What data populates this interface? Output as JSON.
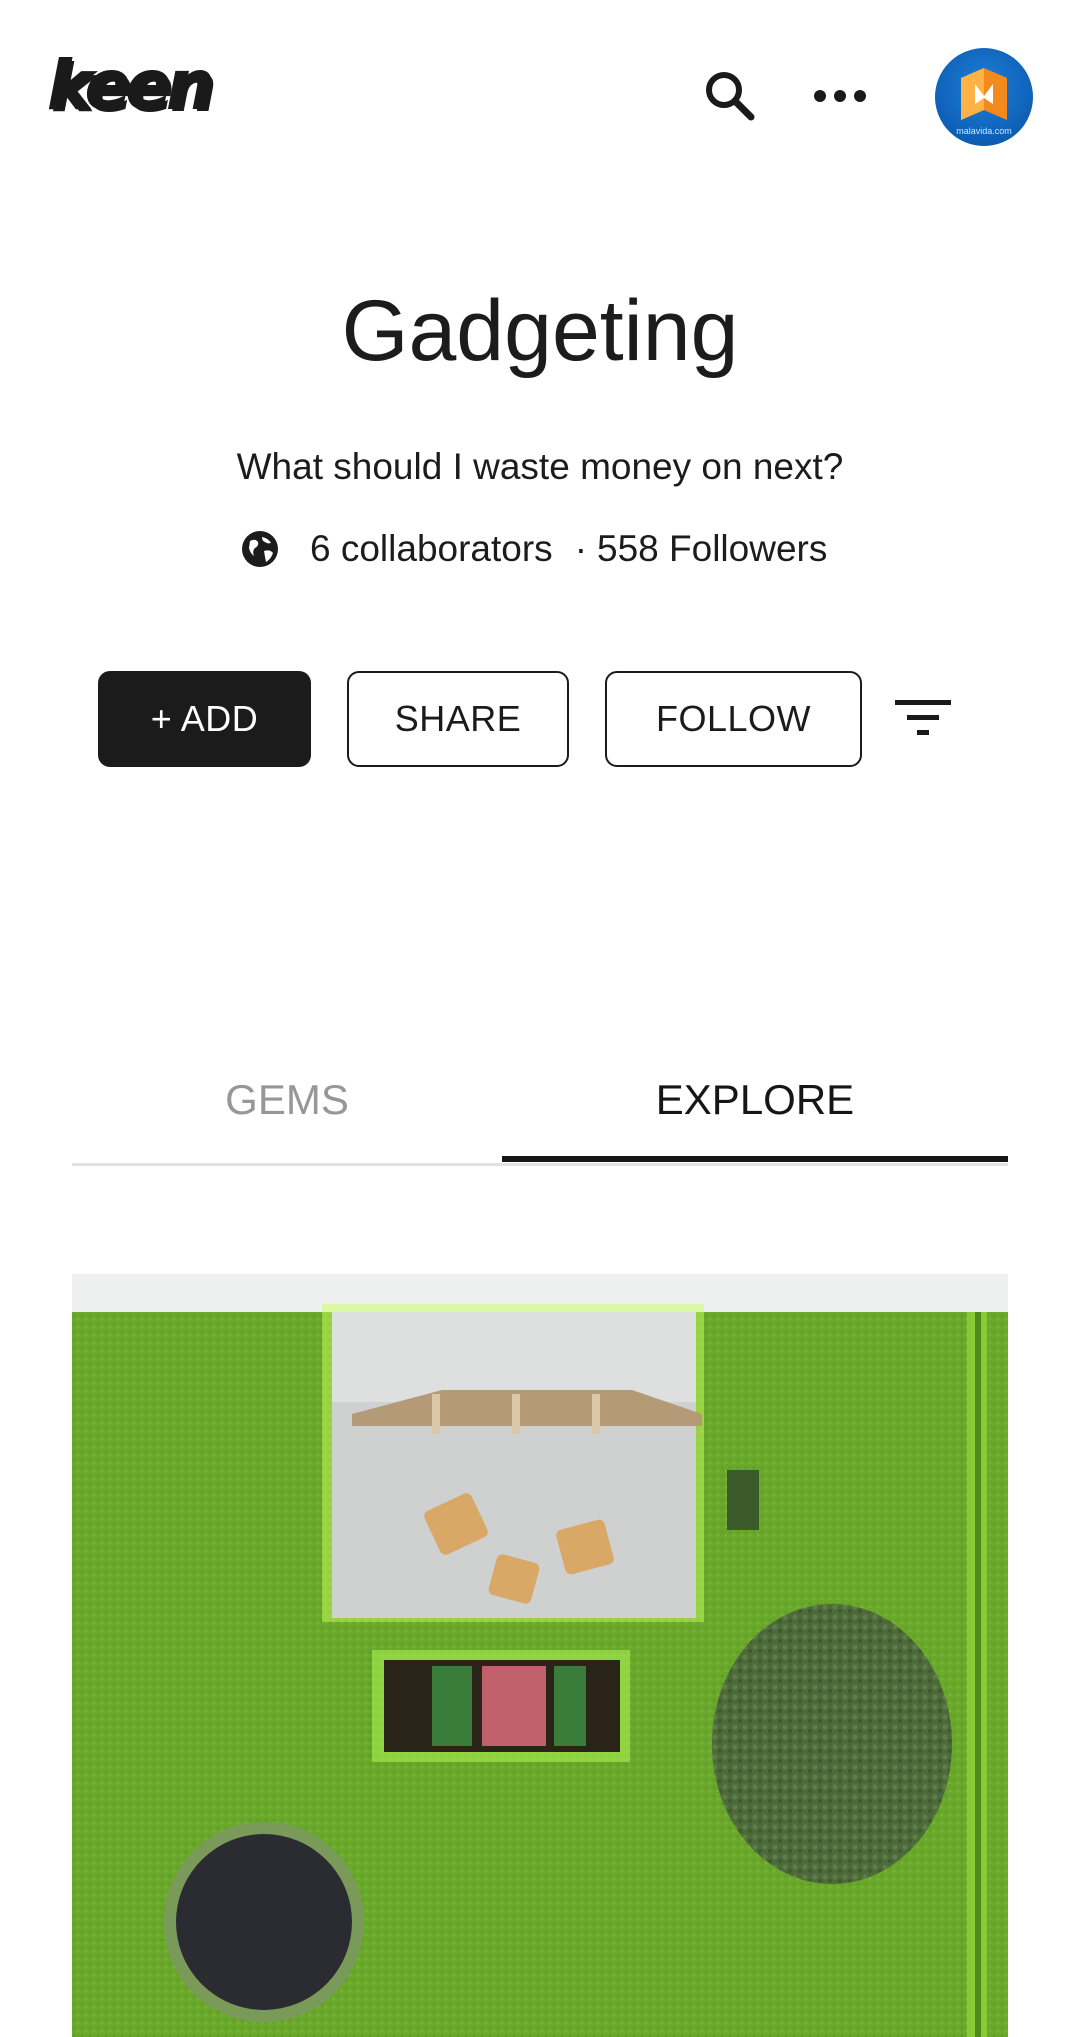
{
  "header": {
    "logo_text": "keen",
    "search_icon": "search-icon",
    "more_icon": "more-horizontal-icon",
    "avatar_caption": "malavida.com"
  },
  "board": {
    "title": "Gadgeting",
    "description": "What should I waste money on next?",
    "visibility_icon": "globe-icon",
    "collaborators": "6 collaborators",
    "separator": "·",
    "followers": "558 Followers"
  },
  "actions": {
    "add_label": "+ ADD",
    "share_label": "SHARE",
    "follow_label": "FOLLOW",
    "filter_icon": "filter-icon"
  },
  "tabs": [
    {
      "label": "GEMS",
      "active": false
    },
    {
      "label": "EXPLORE",
      "active": true
    }
  ],
  "colors": {
    "text": "#1c1c1c",
    "inactive_tab": "#979797",
    "primary_button": "#1b1b1b",
    "grass": "#6aab2c"
  }
}
